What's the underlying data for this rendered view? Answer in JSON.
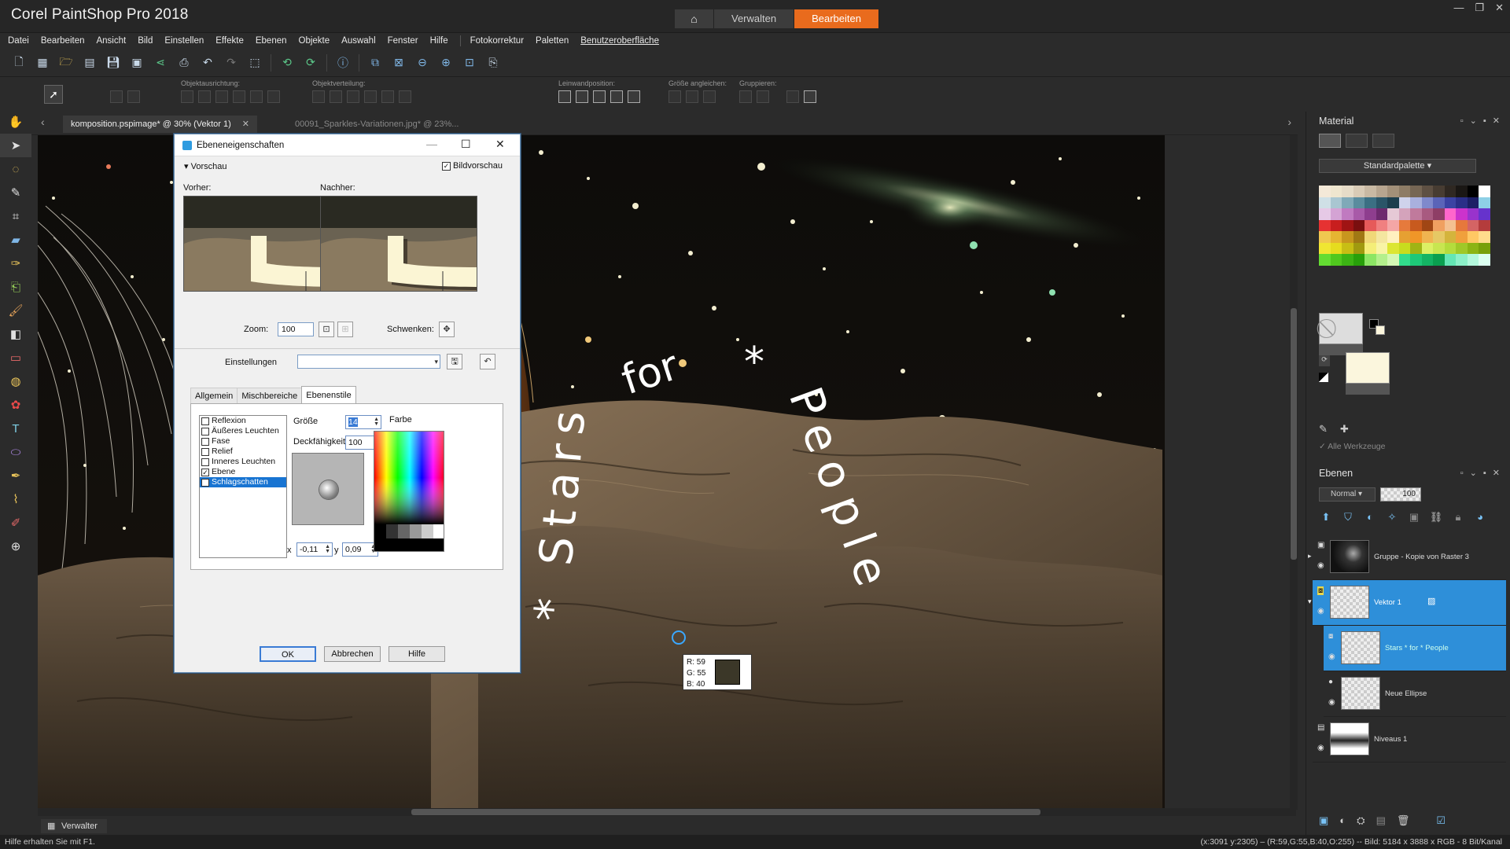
{
  "app": {
    "title": "Corel PaintShop Pro 2018",
    "workspace_tabs": [
      "Verwalten",
      "Bearbeiten"
    ],
    "active_tab": "Bearbeiten",
    "home_icon": "home-icon"
  },
  "menu": [
    "Datei",
    "Bearbeiten",
    "Ansicht",
    "Bild",
    "Einstellen",
    "Effekte",
    "Ebenen",
    "Objekte",
    "Auswahl",
    "Fenster",
    "Hilfe",
    "Fotokorrektur",
    "Paletten",
    "Benutzeroberfläche"
  ],
  "options_bar": {
    "labels": [
      "Objektausrichtung:",
      "Objektverteilung:",
      "Leinwandposition:",
      "Größe angleichen:",
      "Gruppieren:"
    ]
  },
  "document_tabs": {
    "active": "komposition.pspimage* @  30% (Vektor 1)",
    "inactive": "00091_Sparkles-Variationen.jpg* @  23%..."
  },
  "canvas_text": {
    "arc_left": "* Stars",
    "arc_top": "for",
    "arc_star": "*",
    "arc_right": "People"
  },
  "dialog": {
    "title": "Ebeneneigenschaften",
    "preview_section": "Vorschau",
    "live_preview_label": "Bildvorschau",
    "live_preview_checked": true,
    "before_label": "Vorher:",
    "after_label": "Nachher:",
    "zoom_label": "Zoom:",
    "zoom_value": "100",
    "pan_label": "Schwenken:",
    "settings_label": "Einstellungen",
    "tabs": [
      "Allgemein",
      "Mischbereiche",
      "Ebenenstile"
    ],
    "active_tab": "Ebenenstile",
    "effects": [
      {
        "label": "Reflexion",
        "checked": false
      },
      {
        "label": "Äußeres Leuchten",
        "checked": false
      },
      {
        "label": "Fase",
        "checked": false
      },
      {
        "label": "Relief",
        "checked": false
      },
      {
        "label": "Inneres Leuchten",
        "checked": false
      },
      {
        "label": "Ebene",
        "checked": true
      },
      {
        "label": "Schlagschatten",
        "checked": true
      }
    ],
    "size_label": "Größe",
    "size_value": "14",
    "opacity_label": "Deckfähigkeit",
    "opacity_value": "100",
    "color_label": "Farbe",
    "x_label": "x",
    "x_value": "-0,11",
    "y_label": "y",
    "y_value": "0,09",
    "ok": "OK",
    "cancel": "Abbrechen",
    "help": "Hilfe"
  },
  "pixel_tooltip": {
    "r": "R: 59",
    "g": "G: 55",
    "b": "B: 40",
    "swatch_color": "#3b3728"
  },
  "material_panel": {
    "title": "Material",
    "palette": "Standardpalette",
    "all_tools": "Alle Werkzeuge"
  },
  "layers_panel": {
    "title": "Ebenen",
    "blend_mode": "Normal",
    "opacity": "100",
    "layers": [
      {
        "name": "Gruppe - Kopie von Raster 3",
        "selected": false
      },
      {
        "name": "Vektor 1",
        "selected": true
      },
      {
        "name": "Stars * for * People",
        "selected": true
      },
      {
        "name": "Neue Ellipse",
        "selected": false
      },
      {
        "name": "Niveaus 1",
        "selected": false
      }
    ]
  },
  "bottom": {
    "manager": "Verwalter"
  },
  "status": {
    "left": "Hilfe erhalten Sie mit F1.",
    "right": "(x:3091 y:2305) – (R:59,G:55,B:40,O:255) -- Bild:  5184 x 3888 x RGB - 8 Bit/Kanal"
  },
  "colors": {
    "accent_orange": "#e96b1d",
    "selection_blue": "#2e8fd9"
  }
}
